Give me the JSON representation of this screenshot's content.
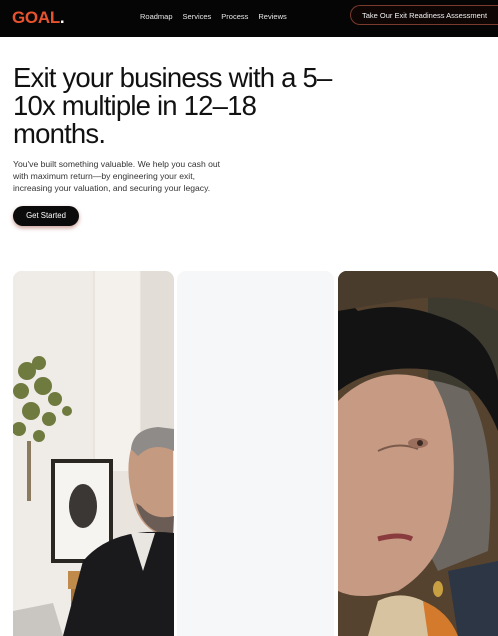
{
  "brand": {
    "name": "GOAL",
    "dot": ".",
    "accent_color": "#e8532e"
  },
  "nav": {
    "links": [
      "Roadmap",
      "Services",
      "Process",
      "Reviews"
    ],
    "cta_label": "Take Our Exit Readiness Assessment"
  },
  "hero": {
    "title": "Exit your business with a 5–10x multiple in 12–18 months.",
    "subtitle": "You've built something valuable. We help you cash out with maximum return—by engineering your exit, increasing your valuation, and securing your legacy.",
    "button_label": "Get Started"
  },
  "cards": {
    "icons": [
      "businessman-photo",
      "blank-card",
      "elderly-woman-photo"
    ]
  }
}
